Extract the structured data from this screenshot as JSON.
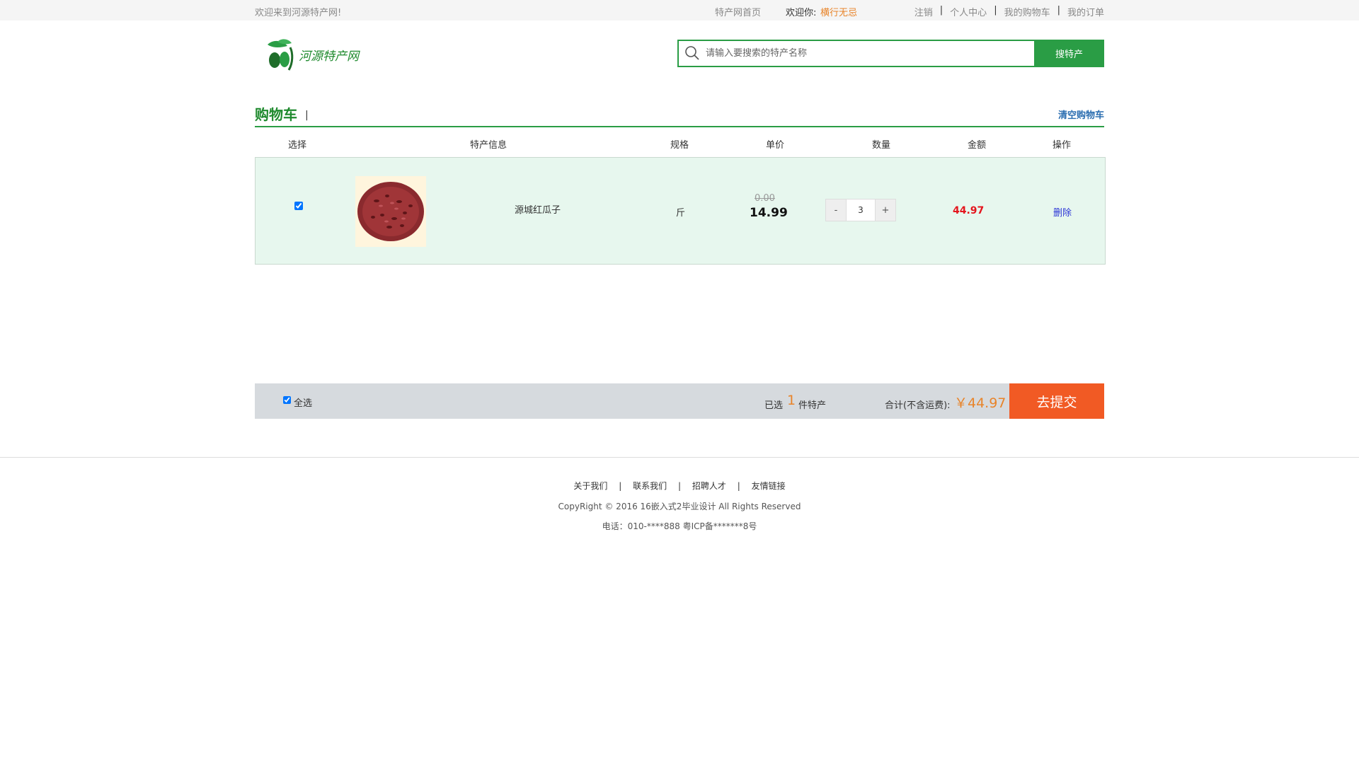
{
  "topbar": {
    "welcome": "欢迎来到河源特产网!",
    "home": "特产网首页",
    "hello": "欢迎你:",
    "username": "横行无忌",
    "links": [
      "注销",
      "个人中心",
      "我的购物车",
      "我的订单"
    ]
  },
  "header": {
    "logo_text": "河源特产网",
    "search_placeholder": "请输入要搜索的特产名称",
    "search_button": "搜特产"
  },
  "cart": {
    "title": "购物车",
    "title_separator": "|",
    "clear": "清空购物车",
    "columns": [
      "选择",
      "特产信息",
      "规格",
      "单价",
      "数量",
      "金额",
      "操作"
    ],
    "items": [
      {
        "checked": true,
        "name": "源城红瓜子",
        "spec": "斤",
        "old_price": "0.00",
        "price": "14.99",
        "qty_minus": "-",
        "qty": "3",
        "qty_plus": "+",
        "total": "44.97",
        "action": "删除"
      }
    ]
  },
  "summary": {
    "select_all": "全选",
    "selected_prefix": "已选",
    "selected_count": "1",
    "selected_suffix": "件特产",
    "total_label": "合计(不含运费):",
    "total_amount": "￥44.97",
    "submit": "去提交"
  },
  "footer": {
    "links": [
      "关于我们",
      "联系我们",
      "招聘人才",
      "友情链接"
    ],
    "link_separator": "|",
    "copyright": "CopyRight © 2016 16嵌入式2毕业设计 All Rights Reserved",
    "phone": "电话：010-****888 粤ICP备*******8号"
  },
  "colors": {
    "brand_green": "#2a9d45",
    "accent_orange": "#e8842a",
    "submit_orange": "#f15a24",
    "price_red": "#e4151d",
    "row_bg": "#e7f7ee"
  }
}
